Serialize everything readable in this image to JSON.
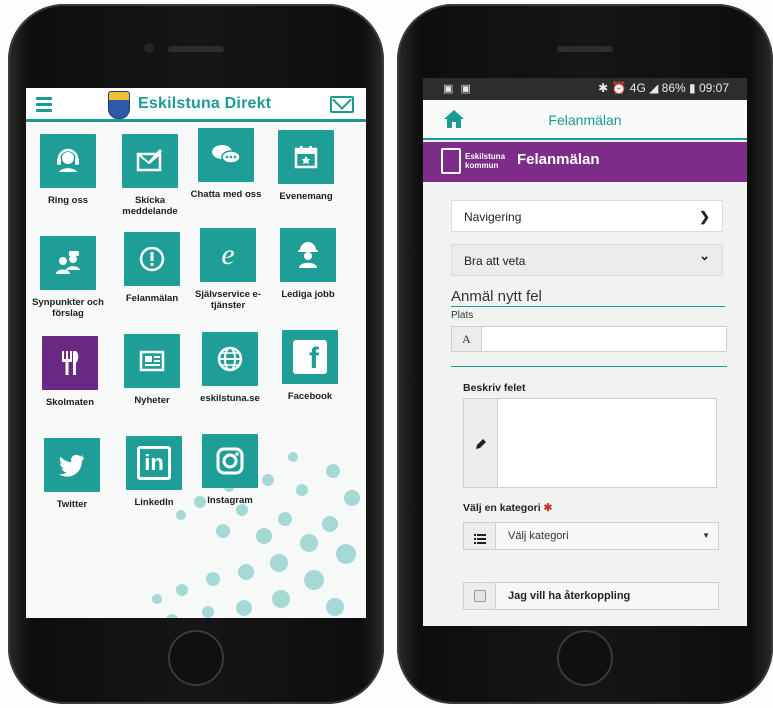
{
  "left_app": {
    "title": "Eskilstuna Direkt",
    "colors": {
      "accent": "#1e9a94",
      "tile": "#1f9e98",
      "tile_highlight": "#6a2a83"
    },
    "tiles": [
      {
        "label": "Ring oss",
        "icon": "headset-icon"
      },
      {
        "label": "Skicka meddelande",
        "icon": "envelope-pen-icon"
      },
      {
        "label": "Chatta med oss",
        "icon": "chat-bubbles-icon"
      },
      {
        "label": "Evenemang",
        "icon": "calendar-icon"
      },
      {
        "label": "Synpunkter och förslag",
        "icon": "people-feedback-icon"
      },
      {
        "label": "Felanmälan",
        "icon": "exclamation-icon"
      },
      {
        "label": "Självservice e-tjänster",
        "icon": "e-service-icon"
      },
      {
        "label": "Lediga jobb",
        "icon": "worker-icon"
      },
      {
        "label": "Skolmaten",
        "icon": "fork-knife-icon"
      },
      {
        "label": "Nyheter",
        "icon": "newspaper-icon"
      },
      {
        "label": "eskilstuna.se",
        "icon": "globe-icon"
      },
      {
        "label": "Facebook",
        "icon": "facebook-icon"
      },
      {
        "label": "Twitter",
        "icon": "twitter-icon"
      },
      {
        "label": "LinkedIn",
        "icon": "linkedin-icon"
      },
      {
        "label": "Instagram",
        "icon": "instagram-icon"
      }
    ],
    "glyphs": {
      "exclamation": "!",
      "e_service": "e",
      "facebook": "f",
      "linkedin": "in"
    }
  },
  "right_app": {
    "status_bar": {
      "icons": "▣ ▣",
      "right_text": "✱ ⏰ 4G ◢ 86% ▮ 09:07"
    },
    "header_title": "Felanmälan",
    "banner": {
      "logo_text_1": "Eskilstuna",
      "logo_text_2": "kommun",
      "title": "Felanmälan"
    },
    "accordions": [
      {
        "label": "Navigering",
        "chevron": "❯"
      },
      {
        "label": "Bra att veta",
        "chevron": "⌄"
      }
    ],
    "section_title": "Anmäl nytt fel",
    "plats": {
      "label": "Plats",
      "addon": "A",
      "value": ""
    },
    "beskriv": {
      "label": "Beskriv felet",
      "value": ""
    },
    "kategori": {
      "label": "Välj en kategori",
      "required_mark": "✱",
      "selected": "Välj kategori",
      "caret": "▼"
    },
    "aterkoppling": {
      "label": "Jag vill ha återkoppling",
      "checked": false
    },
    "colors": {
      "accent": "#1a9b94",
      "banner": "#7d2c8a"
    }
  }
}
